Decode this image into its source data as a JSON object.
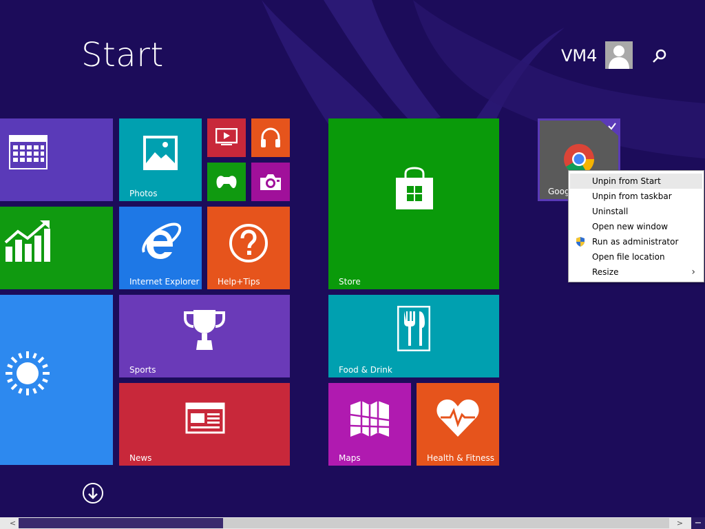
{
  "header": {
    "title": "Start",
    "user_name": "VM4"
  },
  "tiles": {
    "calendar": {
      "label": "",
      "color": "#5a3ab8"
    },
    "photos": {
      "label": "Photos",
      "color": "#00a0b0"
    },
    "video": {
      "label": "",
      "color": "#c8283a"
    },
    "music": {
      "label": "",
      "color": "#e6541c"
    },
    "games": {
      "label": "",
      "color": "#109a10"
    },
    "camera": {
      "label": "",
      "color": "#a0109a"
    },
    "finance": {
      "label": "",
      "color": "#109a10"
    },
    "internet_explorer": {
      "label": "Internet Explorer",
      "color": "#1e78e6"
    },
    "help_tips": {
      "label": "Help+Tips",
      "color": "#e6541c"
    },
    "weather": {
      "label": "",
      "color": "#2d89ef"
    },
    "sports": {
      "label": "Sports",
      "color": "#6a3ab8"
    },
    "news": {
      "label": "News",
      "color": "#c8283a"
    },
    "store": {
      "label": "Store",
      "color": "#0a9a0a"
    },
    "food_drink": {
      "label": "Food & Drink",
      "color": "#00a0b0"
    },
    "maps": {
      "label": "Maps",
      "color": "#b01ab0"
    },
    "health_fitness": {
      "label": "Health & Fitness",
      "color": "#e6541c"
    },
    "google_chrome": {
      "label": "Goog",
      "color": "#5a5a5a",
      "selected": true
    }
  },
  "context_menu": {
    "items": [
      {
        "label": "Unpin from Start",
        "highlighted": true
      },
      {
        "label": "Unpin from taskbar"
      },
      {
        "label": "Uninstall"
      },
      {
        "label": "Open new window"
      },
      {
        "label": "Run as administrator",
        "icon": "uac-shield-icon"
      },
      {
        "label": "Open file location"
      },
      {
        "label": "Resize",
        "submenu_arrow": "›"
      }
    ]
  },
  "scrollbar": {
    "left_arrow": "<",
    "right_arrow": ">",
    "minus": "−"
  }
}
